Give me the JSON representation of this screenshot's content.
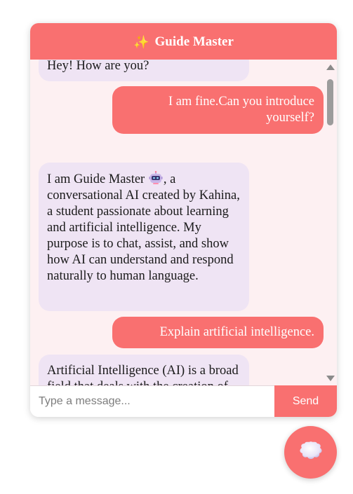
{
  "header": {
    "icon": "sparkles-icon",
    "title": "Guide Master",
    "color": "#f97070"
  },
  "messages": [
    {
      "role": "bot",
      "text": "Hey! How are you?"
    },
    {
      "role": "user",
      "text": "I am fine.Can you introduce yourself?"
    },
    {
      "role": "bot",
      "text_before": "I am Guide Master",
      "icon": "robot-icon",
      "text_after": ", a conversational AI created by Kahina, a student passionate about learning and artificial intelligence. My purpose is to chat, assist, and show how AI can understand and respond naturally to human language."
    },
    {
      "role": "user",
      "text": "Explain artificial intelligence."
    },
    {
      "role": "bot",
      "text": "Artificial Intelligence (AI) is a broad field that deals with the creation of intelligent machines"
    }
  ],
  "composer": {
    "placeholder": "Type a message...",
    "value": "",
    "send_label": "Send"
  },
  "launcher": {
    "icon": "chat-bubble-icon"
  },
  "colors": {
    "accent": "#f97070",
    "bot_bubble": "#efe4f4",
    "chat_background": "#fdf0f2"
  }
}
